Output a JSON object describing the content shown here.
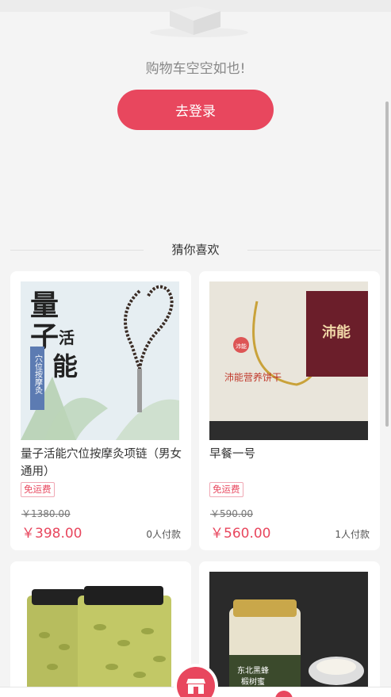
{
  "cart": {
    "empty_text": "购物车空空如也!",
    "login_button": "去登录"
  },
  "recommend": {
    "title": "猜你喜欢",
    "products": [
      {
        "title": "量子活能穴位按摩灸项链（男女通用）",
        "tag": "免运费",
        "original_price": "￥1380.00",
        "price": "￥398.00",
        "sold": "0人付款",
        "image_text": [
          "量",
          "子",
          "活",
          "能",
          "穴位按摩灸"
        ]
      },
      {
        "title": "早餐一号",
        "tag": "免运费",
        "original_price": "￥590.00",
        "price": "￥560.00",
        "sold": "1人付款",
        "image_text": [
          "沛能",
          "沛能营养饼干",
          "沛能"
        ]
      },
      {
        "title": "",
        "image_text": []
      },
      {
        "title": "",
        "image_text": [
          "东北黑蜂",
          "椴树蜜"
        ]
      }
    ]
  },
  "colors": {
    "accent": "#e8475e",
    "background": "#f4f4f4"
  },
  "icons": {
    "fab": "shop-icon"
  }
}
